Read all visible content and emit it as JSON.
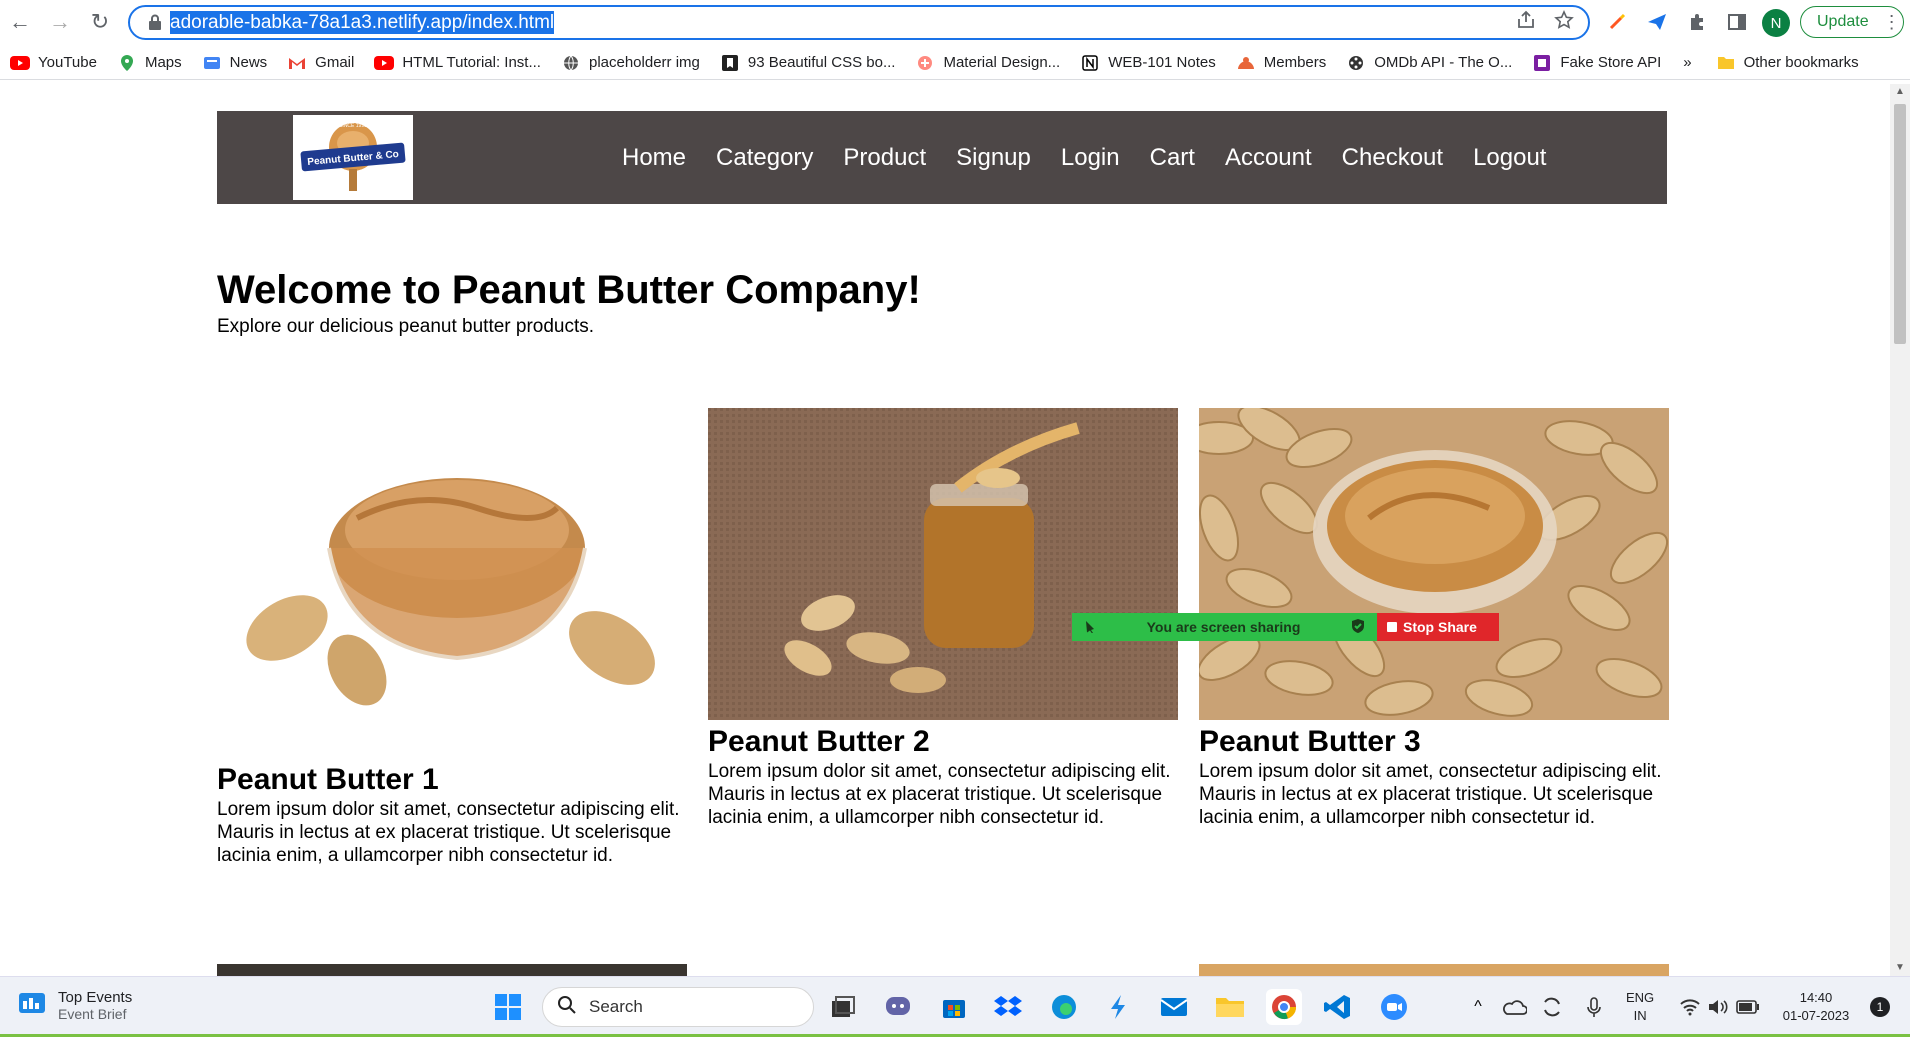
{
  "browser": {
    "url_highlighted": "adorable-babka-78a1a3.netlify.app/index.html",
    "avatar_letter": "N",
    "update_label": "Update",
    "update_menu": "⋮",
    "bookmarks": [
      {
        "label": "YouTube",
        "icon": "youtube-icon",
        "color": "#ff0000"
      },
      {
        "label": "Maps",
        "icon": "maps-icon",
        "color": "#34a853"
      },
      {
        "label": "News",
        "icon": "news-icon",
        "color": "#4285f4"
      },
      {
        "label": "Gmail",
        "icon": "gmail-icon",
        "color": "#ea4335"
      },
      {
        "label": "HTML Tutorial: Inst...",
        "icon": "youtube-icon",
        "color": "#ff0000"
      },
      {
        "label": "placeholderr img",
        "icon": "globe-icon",
        "color": "#555555"
      },
      {
        "label": "93 Beautiful CSS bo...",
        "icon": "bookmark-icon",
        "color": "#222222"
      },
      {
        "label": "Material Design...",
        "icon": "material-icon",
        "color": "#ff8a80"
      },
      {
        "label": "WEB-101 Notes",
        "icon": "notion-icon",
        "color": "#000000"
      },
      {
        "label": "Members",
        "icon": "members-icon",
        "color": "#e8663a"
      },
      {
        "label": "OMDb API - The O...",
        "icon": "film-icon",
        "color": "#333333"
      },
      {
        "label": "Fake Store API",
        "icon": "store-icon",
        "color": "#7b1fa2"
      }
    ],
    "more_bookmarks": "»",
    "other_bookmarks": "Other bookmarks"
  },
  "site": {
    "logo_text": "Peanut Butter & Co",
    "logo_small": "SINCE 1998",
    "nav": [
      "Home",
      "Category",
      "Product",
      "Signup",
      "Login",
      "Cart",
      "Account",
      "Checkout",
      "Logout"
    ],
    "title": "Welcome to Peanut Butter Company!",
    "subtitle": "Explore our delicious peanut butter products.",
    "products": [
      {
        "name": "Peanut Butter 1",
        "desc": "Lorem ipsum dolor sit amet, consectetur adipiscing elit. Mauris in lectus at ex placerat tristique. Ut scelerisque lacinia enim, a ullamcorper nibh consectetur id."
      },
      {
        "name": "Peanut Butter 2",
        "desc": "Lorem ipsum dolor sit amet, consectetur adipiscing elit. Mauris in lectus at ex placerat tristique. Ut scelerisque lacinia enim, a ullamcorper nibh consectetur id."
      },
      {
        "name": "Peanut Butter 3",
        "desc": "Lorem ipsum dolor sit amet, consectetur adipiscing elit. Mauris in lectus at ex placerat tristique. Ut scelerisque lacinia enim, a ullamcorper nibh consectetur id."
      }
    ]
  },
  "zoom": {
    "sharing_text": "You are screen sharing",
    "stop_label": "Stop Share"
  },
  "taskbar": {
    "widget_title": "Top Events",
    "widget_sub": "Event Brief",
    "search_label": "Search",
    "lang_top": "ENG",
    "lang_bottom": "IN",
    "time": "14:40",
    "date": "01-07-2023",
    "notif_count": "1"
  }
}
